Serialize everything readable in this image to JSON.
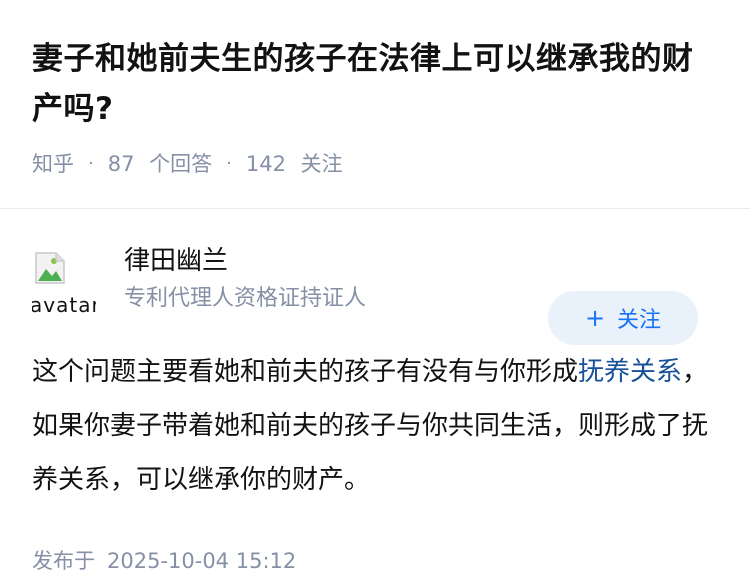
{
  "question": {
    "title": "妻子和她前夫生的孩子在法律上可以继承我的财产吗?",
    "source": "知乎",
    "answers_count": "87",
    "answers_label": "个回答",
    "followers_count": "142",
    "followers_label": "关注"
  },
  "answer": {
    "author": {
      "name": "律田幽兰",
      "headline": "专利代理人资格证持证人",
      "avatar_alt": "avatar"
    },
    "follow_button": {
      "icon": "plus-icon",
      "label": "关注"
    },
    "content": {
      "text_before": "这个问题主要看她和前夫的孩子有没有与你形成",
      "link_text": "抚养关系",
      "text_after": "，如果你妻子带着她和前夫的孩子与你共同生活，则形成了抚养关系，可以继承你的财产。"
    },
    "publish": {
      "label": "发布于",
      "time": "2025-10-04 15:12"
    }
  },
  "colors": {
    "title": "#121212",
    "meta": "#8590a6",
    "link": "#175199",
    "follow_bg": "#e9f1fb",
    "follow_text": "#1772f6"
  }
}
